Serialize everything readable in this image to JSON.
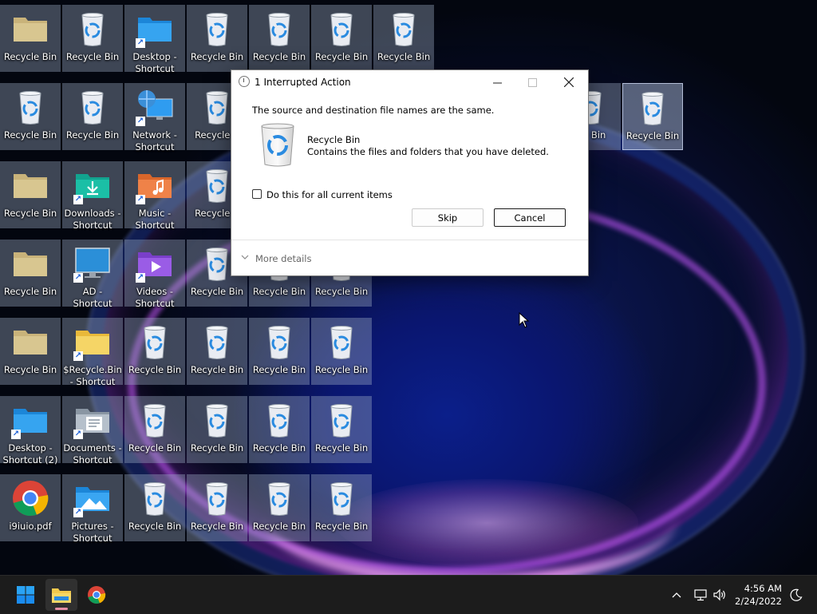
{
  "desktop": {
    "icons": [
      {
        "id": "r0c0",
        "label": "Recycle Bin",
        "kind": "folder"
      },
      {
        "id": "r0c1",
        "label": "Recycle Bin",
        "kind": "bin"
      },
      {
        "id": "r0c2",
        "label": "Desktop - Shortcut",
        "kind": "folder-blue"
      },
      {
        "id": "r0c3",
        "label": "Recycle Bin",
        "kind": "bin"
      },
      {
        "id": "r0c4",
        "label": "Recycle Bin",
        "kind": "bin"
      },
      {
        "id": "r0c5",
        "label": "Recycle Bin",
        "kind": "bin"
      },
      {
        "id": "r0c6",
        "label": "Recycle Bin",
        "kind": "bin"
      },
      {
        "id": "r1c0",
        "label": "Recycle Bin",
        "kind": "bin"
      },
      {
        "id": "r1c1",
        "label": "Recycle Bin",
        "kind": "bin"
      },
      {
        "id": "r1c2",
        "label": "Network - Shortcut",
        "kind": "network"
      },
      {
        "id": "r1c3",
        "label": "Recycle B",
        "kind": "bin"
      },
      {
        "id": "r1c9",
        "label": "cle Bin",
        "kind": "bin"
      },
      {
        "id": "r1c10",
        "label": "Recycle Bin",
        "kind": "bin"
      },
      {
        "id": "r2c0",
        "label": "Recycle Bin",
        "kind": "folder"
      },
      {
        "id": "r2c1",
        "label": "Downloads - Shortcut",
        "kind": "downloads"
      },
      {
        "id": "r2c2",
        "label": "Music - Shortcut",
        "kind": "music"
      },
      {
        "id": "r2c3",
        "label": "Recycle B",
        "kind": "bin"
      },
      {
        "id": "r3c0",
        "label": "Recycle Bin",
        "kind": "folder"
      },
      {
        "id": "r3c1",
        "label": "AD - Shortcut",
        "kind": "monitor"
      },
      {
        "id": "r3c2",
        "label": "Videos - Shortcut",
        "kind": "videos"
      },
      {
        "id": "r3c3",
        "label": "Recycle Bin",
        "kind": "bin"
      },
      {
        "id": "r3c4",
        "label": "Recycle Bin",
        "kind": "bin"
      },
      {
        "id": "r3c5",
        "label": "Recycle Bin",
        "kind": "bin"
      },
      {
        "id": "r4c0",
        "label": "Recycle Bin",
        "kind": "folder"
      },
      {
        "id": "r4c1",
        "label": "$Recycle.Bin - Shortcut",
        "kind": "folder-yellow"
      },
      {
        "id": "r4c2",
        "label": "Recycle Bin",
        "kind": "bin"
      },
      {
        "id": "r4c3",
        "label": "Recycle Bin",
        "kind": "bin"
      },
      {
        "id": "r4c4",
        "label": "Recycle Bin",
        "kind": "bin"
      },
      {
        "id": "r4c5",
        "label": "Recycle Bin",
        "kind": "bin"
      },
      {
        "id": "r5c0",
        "label": "Desktop - Shortcut (2)",
        "kind": "folder-blue"
      },
      {
        "id": "r5c1",
        "label": "Documents - Shortcut",
        "kind": "documents"
      },
      {
        "id": "r5c2",
        "label": "Recycle Bin",
        "kind": "bin"
      },
      {
        "id": "r5c3",
        "label": "Recycle Bin",
        "kind": "bin"
      },
      {
        "id": "r5c4",
        "label": "Recycle Bin",
        "kind": "bin"
      },
      {
        "id": "r5c5",
        "label": "Recycle Bin",
        "kind": "bin"
      },
      {
        "id": "r6c0",
        "label": "i9iuio.pdf",
        "kind": "chrome"
      },
      {
        "id": "r6c1",
        "label": "Pictures - Shortcut",
        "kind": "pictures"
      },
      {
        "id": "r6c2",
        "label": "Recycle Bin",
        "kind": "bin"
      },
      {
        "id": "r6c3",
        "label": "Recycle Bin",
        "kind": "bin"
      },
      {
        "id": "r6c4",
        "label": "Recycle Bin",
        "kind": "bin"
      },
      {
        "id": "r6c5",
        "label": "Recycle Bin",
        "kind": "bin"
      }
    ]
  },
  "dialog": {
    "title": "1 Interrupted Action",
    "message": "The source and destination file names are the same.",
    "item_name": "Recycle Bin",
    "item_description": "Contains the files and folders that you have deleted.",
    "checkbox_label": "Do this for all current items",
    "checkbox_checked": false,
    "skip_label": "Skip",
    "cancel_label": "Cancel",
    "more_details_label": "More details"
  },
  "taskbar": {
    "time": "4:56 AM",
    "date": "2/24/2022",
    "apps": [
      "start-icon",
      "file-explorer-icon",
      "chrome-icon"
    ]
  },
  "colors": {
    "taskbar_bg": "#1c1c1c",
    "win_blue": "#1a8cf0",
    "folder_yellow": "#f2c94c"
  }
}
